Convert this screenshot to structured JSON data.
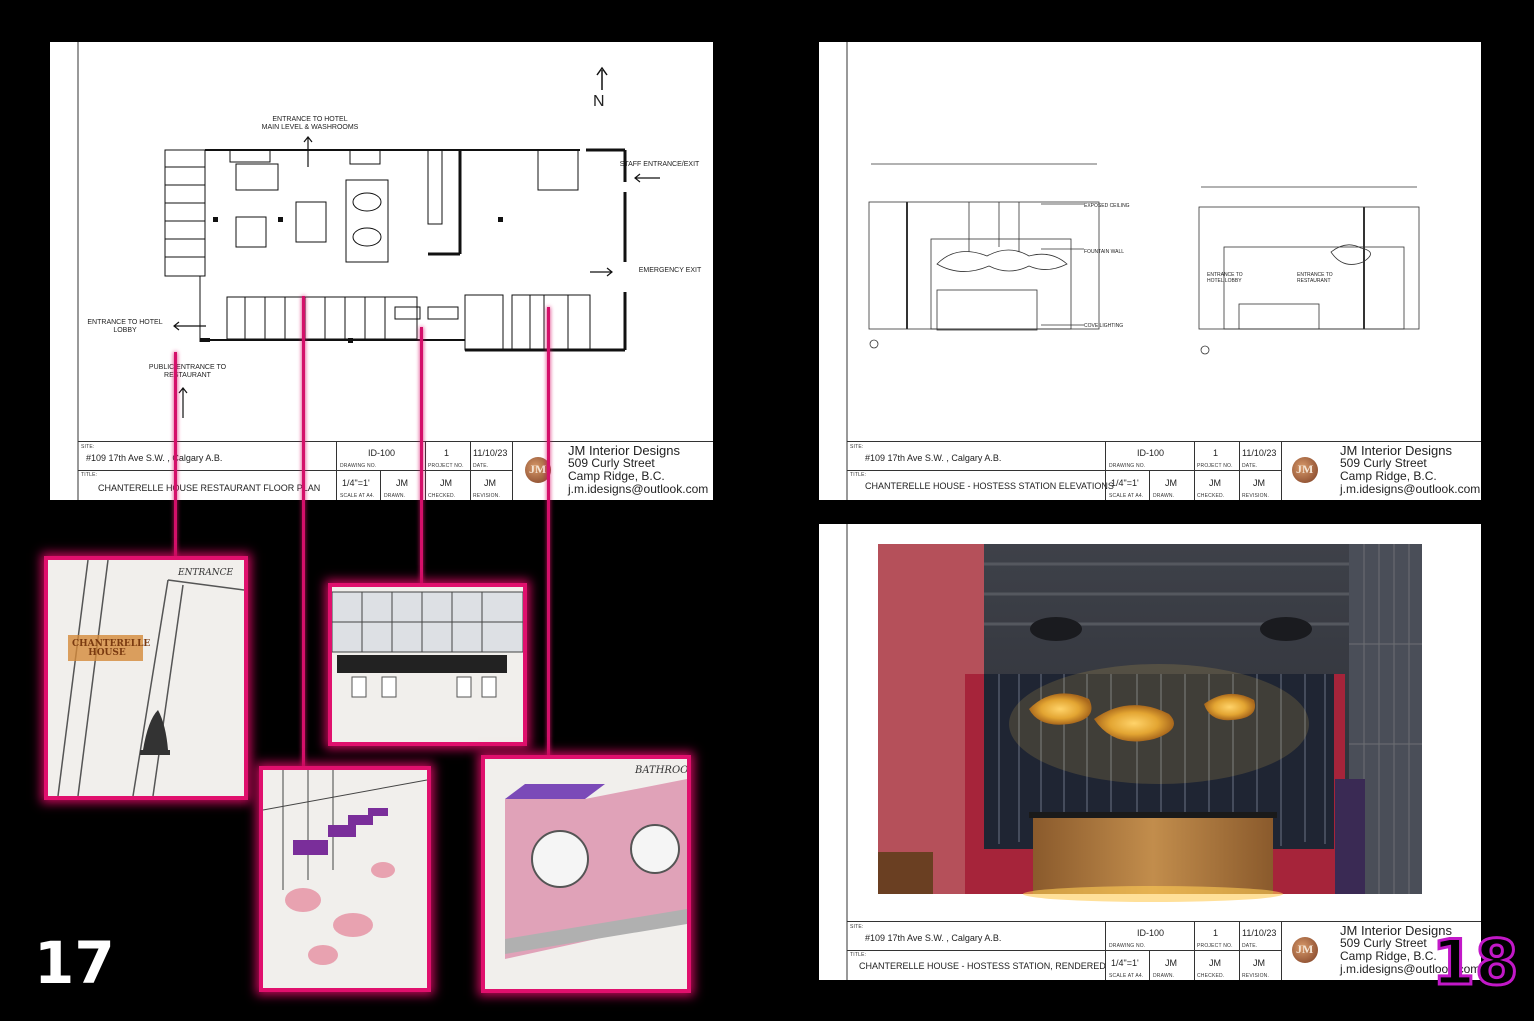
{
  "page_numbers": {
    "left": "17",
    "right": "18"
  },
  "floor_plan": {
    "north_label": "N",
    "labels": {
      "entrance_hotel_main": "ENTRANCE TO HOTEL\nMAIN LEVEL & WASHROOMS",
      "staff_entrance": "STAFF ENTRANCE/EXIT",
      "emergency_exit": "EMERGENCY EXIT",
      "entrance_hotel_lobby": "ENTRANCE TO HOTEL\nLOBBY",
      "public_entrance": "PUBLIC ENTRANCE TO\nRESTAURANT"
    }
  },
  "elevations": {
    "labels": {
      "exposed_ceiling": "EXPOSED CEILING",
      "fountain_wall": "FOUNTAIN WALL",
      "cove_lighting": "COVE LIGHTING",
      "entrance_lobby": "ENTRANCE TO\nHOTEL LOBBY",
      "entrance_restaurant": "ENTRANCE TO\nRESTAURANT"
    }
  },
  "title_blocks": [
    {
      "site_label": "SITE:",
      "site": "#109 17th Ave S.W. , Calgary A.B.",
      "title_label": "TITLE:",
      "title": "CHANTERELLE HOUSE RESTAURANT FLOOR PLAN",
      "drawing_no": "ID-100",
      "drawing_no_label": "DRAWING NO.",
      "project_no": "1",
      "project_no_label": "PROJECT NO.",
      "date": "11/10/23",
      "date_label": "DATE.",
      "scale": "1/4\"=1'",
      "scale_label": "SCALE AT A4.",
      "drawn": "JM",
      "drawn_label": "DRAWN.",
      "checked": "JM",
      "checked_label": "CHECKED.",
      "revision": "JM",
      "revision_label": "REVISION.",
      "firm": "JM Interior Designs",
      "address1": "509 Curly Street",
      "address2": "Camp Ridge, B.C.",
      "email": "j.m.idesigns@outlook.com"
    },
    {
      "site_label": "SITE:",
      "site": "#109 17th Ave S.W. , Calgary A.B.",
      "title_label": "TITLE:",
      "title": "CHANTERELLE HOUSE - HOSTESS STATION ELEVATIONS",
      "drawing_no": "ID-100",
      "drawing_no_label": "DRAWING NO.",
      "project_no": "1",
      "project_no_label": "PROJECT NO.",
      "date": "11/10/23",
      "date_label": "DATE.",
      "scale": "1/4\"=1'",
      "scale_label": "SCALE AT A4.",
      "drawn": "JM",
      "drawn_label": "DRAWN.",
      "checked": "JM",
      "checked_label": "CHECKED.",
      "revision": "JM",
      "revision_label": "REVISION.",
      "firm": "JM Interior Designs",
      "address1": "509 Curly Street",
      "address2": "Camp Ridge, B.C.",
      "email": "j.m.idesigns@outlook.com"
    },
    {
      "site_label": "SITE:",
      "site": "#109 17th Ave S.W. , Calgary A.B.",
      "title_label": "TITLE:",
      "title": "CHANTERELLE HOUSE - HOSTESS STATION, RENDERED",
      "drawing_no": "ID-100",
      "drawing_no_label": "DRAWING NO.",
      "project_no": "1",
      "project_no_label": "PROJECT NO.",
      "date": "11/10/23",
      "date_label": "DATE.",
      "scale": "1/4\"=1'",
      "scale_label": "SCALE AT A4.",
      "drawn": "JM",
      "drawn_label": "DRAWN.",
      "checked": "JM",
      "checked_label": "CHECKED.",
      "revision": "JM",
      "revision_label": "REVISION.",
      "firm": "JM Interior Designs",
      "address1": "509 Curly Street",
      "address2": "Camp Ridge, B.C.",
      "email": "j.m.idesigns@outlook.com"
    }
  ],
  "sketches": {
    "entrance": {
      "title": "ENTRANCE",
      "sign": "CHANTERELLE HOUSE"
    },
    "bathroom": {
      "title": "BATHROOM"
    }
  },
  "colors": {
    "accent": "#e0106d",
    "page_number_right": "#c218c8",
    "render_wall": "#b5505a"
  }
}
